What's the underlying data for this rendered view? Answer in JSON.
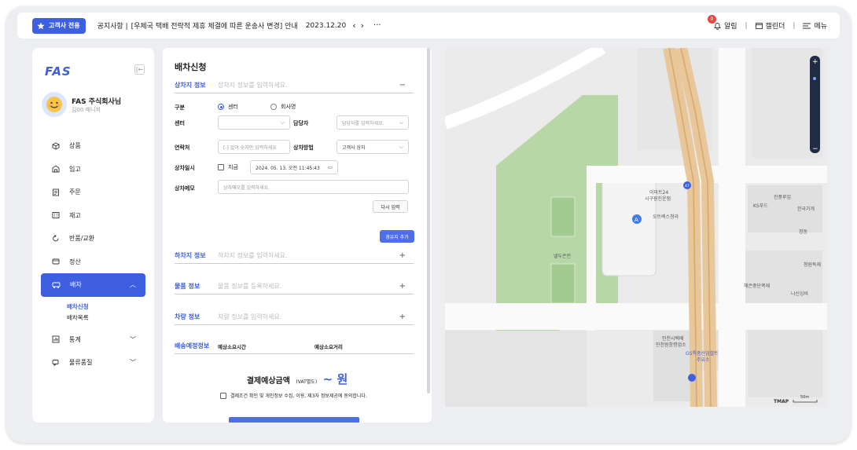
{
  "topbar": {
    "badge": "고객사 전용",
    "notice_label": "공지사항 |",
    "notice_text": "[우체국 택배 전략적 제휴 체결에 따른 운송사 변경] 안내",
    "notice_date": "2023.12.20",
    "prev": "‹",
    "next": "›",
    "more": "···",
    "alarm_count": "0",
    "alarm": "알림",
    "calendar": "캘린더",
    "menu": "메뉴"
  },
  "sidebar": {
    "logo": "FAS",
    "collapse": "|←",
    "company": "FAS 주식회사님",
    "user": "김00 매니저",
    "items": [
      {
        "label": "상품",
        "icon": "cube-icon"
      },
      {
        "label": "입고",
        "icon": "warehouse-icon"
      },
      {
        "label": "주문",
        "icon": "receipt-icon"
      },
      {
        "label": "재고",
        "icon": "grid-icon"
      },
      {
        "label": "반품/교환",
        "icon": "return-icon"
      },
      {
        "label": "정산",
        "icon": "wallet-icon"
      },
      {
        "label": "배차",
        "icon": "truck-icon"
      },
      {
        "label": "통계",
        "icon": "chart-icon"
      },
      {
        "label": "물류품질",
        "icon": "chat-icon"
      }
    ],
    "sub_items": [
      "배차신청",
      "배차목록"
    ],
    "accent": "#3d5fe0"
  },
  "form": {
    "title": "배차신청",
    "pickup": {
      "label": "상차지 정보",
      "placeholder": "상차지 정보를 입력하세요.",
      "toggle": "−"
    },
    "type_label": "구분",
    "type_options": [
      "센터",
      "회사명"
    ],
    "center_label": "센터",
    "manager_label": "담당자",
    "manager_placeholder": "담당자를 입력하세요.",
    "contact_label": "연락처",
    "contact_placeholder": "[-] 없이 숫자만 입력하세요",
    "method_label": "상차방법",
    "method_value": "고객사 상차",
    "datetime_label": "상차일시",
    "now_label": "지금",
    "datetime_value": "2024. 05. 13. 오전 11:45:43",
    "memo_label": "상차메모",
    "memo_placeholder": "상차메모를 입력하세요.",
    "reset": "다시 입력",
    "add_stop": "경유지 추가",
    "dropoff": {
      "label": "하차지 정보",
      "placeholder": "하차지 정보를 입력하세요.",
      "toggle": "+"
    },
    "goods": {
      "label": "물품 정보",
      "placeholder": "물품 정보를 등록하세요.",
      "toggle": "+"
    },
    "vehicle": {
      "label": "차량 정보",
      "placeholder": "차량 정보를 입력하세요.",
      "toggle": "+"
    },
    "delivery_label": "배송예정정보",
    "est_time": "예상소요시간",
    "est_dist": "예상소요거리",
    "total_label": "결제예상금액",
    "vat": "(VAT별도)",
    "amount": "~ 원",
    "agree": "결제조건 확인 및 개인정보 수집, 이용, 제3자 정보제공에 동의합니다."
  },
  "map": {
    "labels": [
      "이마트24",
      "시구원진운점",
      "오트렉스청라",
      "낼두은린",
      "인천시택배",
      "인천원창령업소",
      "GS특중산업셀트",
      "주유소",
      "진풍루입",
      "KS푸드",
      "한국가게",
      "정동",
      "청원독재",
      "해은중단쪽재",
      "나신싱비"
    ],
    "road_sign": "47",
    "scale": "TMAP",
    "scale_value": "50m",
    "zoom_in": "+",
    "zoom_out": "−"
  }
}
